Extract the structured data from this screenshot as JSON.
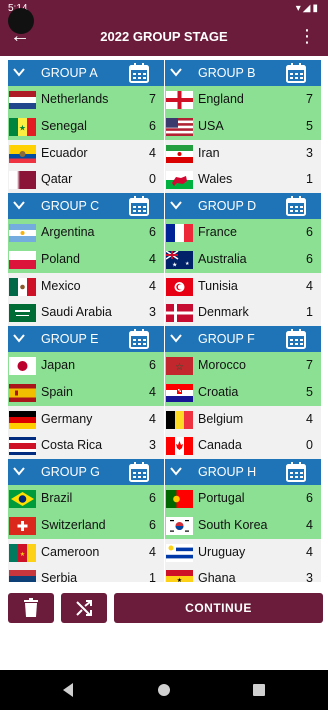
{
  "status_bar": {
    "time": "5:14",
    "icons": [
      "wifi-icon",
      "signal-icon",
      "battery-icon"
    ]
  },
  "app_bar": {
    "title": "2022 GROUP STAGE"
  },
  "colors": {
    "primary": "#6b1c3a",
    "group_header": "#1e74b7",
    "qualified_row": "#8ce093",
    "row": "#f1f1f1"
  },
  "groups": [
    {
      "name": "GROUP A",
      "teams": [
        {
          "name": "Netherlands",
          "points": "7",
          "flag": "nl"
        },
        {
          "name": "Senegal",
          "points": "6",
          "flag": "sn"
        },
        {
          "name": "Ecuador",
          "points": "4",
          "flag": "ec"
        },
        {
          "name": "Qatar",
          "points": "0",
          "flag": "qa"
        }
      ]
    },
    {
      "name": "GROUP B",
      "teams": [
        {
          "name": "England",
          "points": "7",
          "flag": "en"
        },
        {
          "name": "USA",
          "points": "5",
          "flag": "us"
        },
        {
          "name": "Iran",
          "points": "3",
          "flag": "ir"
        },
        {
          "name": "Wales",
          "points": "1",
          "flag": "wa"
        }
      ]
    },
    {
      "name": "GROUP C",
      "teams": [
        {
          "name": "Argentina",
          "points": "6",
          "flag": "ar"
        },
        {
          "name": "Poland",
          "points": "4",
          "flag": "pl"
        },
        {
          "name": "Mexico",
          "points": "4",
          "flag": "mx"
        },
        {
          "name": "Saudi Arabia",
          "points": "3",
          "flag": "sa"
        }
      ]
    },
    {
      "name": "GROUP D",
      "teams": [
        {
          "name": "France",
          "points": "6",
          "flag": "fr"
        },
        {
          "name": "Australia",
          "points": "6",
          "flag": "au"
        },
        {
          "name": "Tunisia",
          "points": "4",
          "flag": "tn"
        },
        {
          "name": "Denmark",
          "points": "1",
          "flag": "dk"
        }
      ]
    },
    {
      "name": "GROUP E",
      "teams": [
        {
          "name": "Japan",
          "points": "6",
          "flag": "jp"
        },
        {
          "name": "Spain",
          "points": "4",
          "flag": "es"
        },
        {
          "name": "Germany",
          "points": "4",
          "flag": "de"
        },
        {
          "name": "Costa Rica",
          "points": "3",
          "flag": "cr"
        }
      ]
    },
    {
      "name": "GROUP F",
      "teams": [
        {
          "name": "Morocco",
          "points": "7",
          "flag": "ma"
        },
        {
          "name": "Croatia",
          "points": "5",
          "flag": "hr"
        },
        {
          "name": "Belgium",
          "points": "4",
          "flag": "be"
        },
        {
          "name": "Canada",
          "points": "0",
          "flag": "ca"
        }
      ]
    },
    {
      "name": "GROUP G",
      "teams": [
        {
          "name": "Brazil",
          "points": "6",
          "flag": "br"
        },
        {
          "name": "Switzerland",
          "points": "6",
          "flag": "ch"
        },
        {
          "name": "Cameroon",
          "points": "4",
          "flag": "cm"
        },
        {
          "name": "Serbia",
          "points": "1",
          "flag": "rs"
        }
      ]
    },
    {
      "name": "GROUP H",
      "teams": [
        {
          "name": "Portugal",
          "points": "6",
          "flag": "pt"
        },
        {
          "name": "South Korea",
          "points": "4",
          "flag": "kr"
        },
        {
          "name": "Uruguay",
          "points": "4",
          "flag": "uy"
        },
        {
          "name": "Ghana",
          "points": "3",
          "flag": "gh"
        }
      ]
    }
  ],
  "actions": {
    "continue_label": "CONTINUE",
    "delete_icon": "trash-icon",
    "shuffle_icon": "shuffle-icon"
  },
  "nav": {
    "back": "nav-back-icon",
    "home": "nav-home-icon",
    "recents": "nav-recents-icon"
  }
}
